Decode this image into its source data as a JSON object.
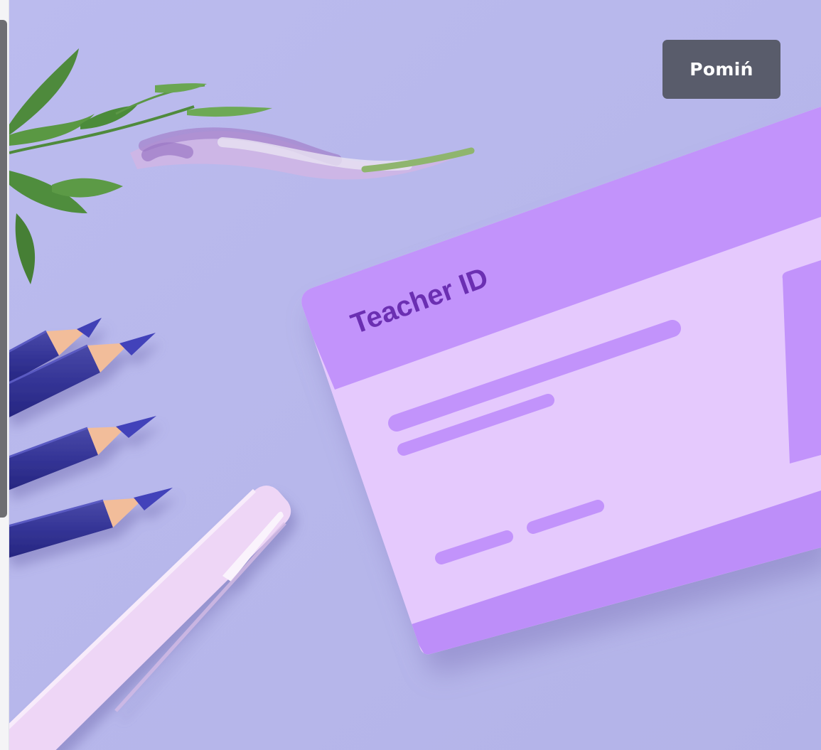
{
  "onboarding": {
    "skip_label": "Pomiń"
  },
  "illustration": {
    "card_title": "Teacher ID",
    "background_color": "#b7b7ec",
    "card_header_color": "#c293fb",
    "card_body_color": "#e5c9fd"
  }
}
